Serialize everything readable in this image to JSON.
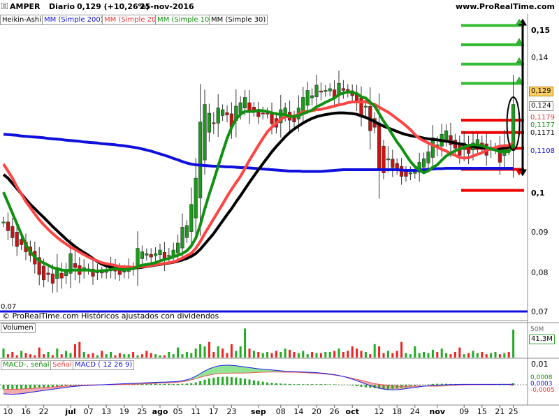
{
  "header": {
    "ticker": "AMPER",
    "period": "Diario",
    "last": "0,129 (+10,26%)",
    "date": "25-nov-2016",
    "site": "www.ProRealTime.com"
  },
  "legend": {
    "chart_style": "Heikin-Ashi",
    "ma200": "MM (Simple 200)",
    "ma20": "MM (Simple 20)",
    "ma10": "MM (Simple 10)",
    "ma30": "MM (Simple 30)"
  },
  "colors": {
    "up": "#1a9a1a",
    "down": "#cc1111",
    "ma200": "#1010dd",
    "ma20": "#ff4444",
    "ma10": "#109010",
    "ma30": "#000000",
    "level_green": "#33bb33",
    "level_red": "#ee0000",
    "macd_line": "#1a1aee",
    "signal_line": "#ee5555"
  },
  "source_text": "© ProRealTime.com Históricos ajustados con dividendos",
  "low_label": "0,07",
  "price_labels": {
    "last": "0,129",
    "mid": "0,124",
    "ma20": "0,1179",
    "ma10": "0,1177",
    "ma30": "0,1171",
    "ma200": "0,1108"
  },
  "volume_panel": {
    "title": "Volumen",
    "value": "41,3M",
    "scale": "50M"
  },
  "macd_panel": {
    "title_hist": "MACD-, señal",
    "title_signal": "Señal",
    "title_macd": "MACD ( 12 26 9)",
    "top_tick": "0,01",
    "hist_value": "0,0008",
    "macd_value": "0,0003",
    "signal_value": "-0,0005"
  },
  "chart_data": {
    "type": "candlestick",
    "ylim": [
      0.07,
      0.156
    ],
    "yticks": [
      "0,15",
      "0,14",
      "0,129",
      "0,124",
      "0,1",
      "0,09",
      "0,08",
      "0,07"
    ],
    "xticks": [
      {
        "label": "10",
        "i": 1
      },
      {
        "label": "16",
        "i": 5
      },
      {
        "label": "22",
        "i": 9
      },
      {
        "label": "jul",
        "i": 15,
        "month": true
      },
      {
        "label": "07",
        "i": 19
      },
      {
        "label": "13",
        "i": 23
      },
      {
        "label": "19",
        "i": 27
      },
      {
        "label": "25",
        "i": 31
      },
      {
        "label": "ago",
        "i": 35,
        "month": true
      },
      {
        "label": "05",
        "i": 39
      },
      {
        "label": "11",
        "i": 43
      },
      {
        "label": "17",
        "i": 47
      },
      {
        "label": "23",
        "i": 51
      },
      {
        "label": "sep",
        "i": 57,
        "month": true
      },
      {
        "label": "08",
        "i": 62
      },
      {
        "label": "14",
        "i": 66
      },
      {
        "label": "20",
        "i": 70
      },
      {
        "label": "26",
        "i": 74
      },
      {
        "label": "oct",
        "i": 78,
        "month": true
      },
      {
        "label": "12",
        "i": 84
      },
      {
        "label": "18",
        "i": 88
      },
      {
        "label": "24",
        "i": 92
      },
      {
        "label": "nov",
        "i": 97,
        "month": true
      },
      {
        "label": "09",
        "i": 103
      },
      {
        "label": "15",
        "i": 107
      },
      {
        "label": "21",
        "i": 111
      },
      {
        "label": "25",
        "i": 114
      }
    ],
    "close": [
      0.0955,
      0.093,
      0.091,
      0.0885,
      0.089,
      0.087,
      0.086,
      0.0835,
      0.0805,
      0.079,
      0.0805,
      0.078,
      0.0825,
      0.0795,
      0.0815,
      0.0865,
      0.0825,
      0.0805,
      0.0825,
      0.082,
      0.08,
      0.0815,
      0.081,
      0.082,
      0.0835,
      0.0815,
      0.0805,
      0.0815,
      0.083,
      0.082,
      0.088,
      0.087,
      0.0865,
      0.0855,
      0.0865,
      0.0875,
      0.0845,
      0.086,
      0.0875,
      0.0895,
      0.094,
      0.0945,
      0.1005,
      0.108,
      0.124,
      0.129,
      0.1265,
      0.1235,
      0.128,
      0.1275,
      0.126,
      0.1225,
      0.1285,
      0.1295,
      0.131,
      0.127,
      0.127,
      0.1255,
      0.1265,
      0.1265,
      0.1235,
      0.1225,
      0.1275,
      0.128,
      0.1245,
      0.124,
      0.128,
      0.131,
      0.133,
      0.1315,
      0.1345,
      0.1325,
      0.133,
      0.1335,
      0.131,
      0.135,
      0.133,
      0.1325,
      0.1315,
      0.1295,
      0.126,
      0.1285,
      0.1215,
      0.1225,
      0.1105,
      0.1095,
      0.1135,
      0.111,
      0.1105,
      0.1085,
      0.1085,
      0.1095,
      0.11,
      0.1125,
      0.1135,
      0.1155,
      0.1195,
      0.1175,
      0.1205,
      0.1215,
      0.1175,
      0.1165,
      0.1145,
      0.118,
      0.115,
      0.118,
      0.119,
      0.1175,
      0.1145,
      0.1165,
      0.1165,
      0.1125,
      0.1175,
      0.117,
      0.129
    ],
    "ma10": [
      0.104,
      0.101,
      0.098,
      0.095,
      0.092,
      0.089,
      0.087,
      0.0855,
      0.0845,
      0.0838,
      0.0832,
      0.0825,
      0.0822,
      0.0818,
      0.0817,
      0.0818,
      0.0818,
      0.0818,
      0.0818,
      0.0818,
      0.0815,
      0.0815,
      0.0816,
      0.0817,
      0.082,
      0.0822,
      0.082,
      0.0819,
      0.0821,
      0.0822,
      0.0828,
      0.0832,
      0.0834,
      0.0836,
      0.0839,
      0.0844,
      0.0848,
      0.0851,
      0.0856,
      0.086,
      0.0865,
      0.0873,
      0.0887,
      0.0909,
      0.0946,
      0.0992,
      0.1034,
      0.1073,
      0.1114,
      0.1154,
      0.1193,
      0.1224,
      0.1248,
      0.1262,
      0.127,
      0.127,
      0.127,
      0.1273,
      0.1272,
      0.127,
      0.1266,
      0.1263,
      0.1262,
      0.1261,
      0.1256,
      0.1256,
      0.1258,
      0.1264,
      0.1269,
      0.1274,
      0.1283,
      0.1289,
      0.1296,
      0.1302,
      0.1308,
      0.1318,
      0.1322,
      0.1326,
      0.1324,
      0.1321,
      0.1312,
      0.1308,
      0.1296,
      0.1285,
      0.1264,
      0.1242,
      0.1224,
      0.1203,
      0.1183,
      0.1166,
      0.1146,
      0.1127,
      0.1113,
      0.1103,
      0.1095,
      0.1101,
      0.1111,
      0.1118,
      0.1131,
      0.1143,
      0.1151,
      0.1158,
      0.1163,
      0.1169,
      0.1173,
      0.1175,
      0.1174,
      0.1172,
      0.1168,
      0.1163,
      0.116,
      0.1155,
      0.1157,
      0.1155,
      0.1177
    ],
    "ma20": [
      0.112,
      0.11,
      0.108,
      0.1055,
      0.1035,
      0.1013,
      0.0996,
      0.0978,
      0.0961,
      0.0947,
      0.0934,
      0.0922,
      0.0911,
      0.0901,
      0.0892,
      0.0883,
      0.0877,
      0.0869,
      0.0862,
      0.0855,
      0.0849,
      0.0844,
      0.0839,
      0.0836,
      0.0834,
      0.0831,
      0.0828,
      0.0827,
      0.0827,
      0.0826,
      0.0826,
      0.0828,
      0.0829,
      0.0831,
      0.0833,
      0.0835,
      0.0837,
      0.0839,
      0.0841,
      0.0846,
      0.0852,
      0.0859,
      0.0866,
      0.088,
      0.0899,
      0.0922,
      0.0943,
      0.0964,
      0.0985,
      0.1006,
      0.1028,
      0.1048,
      0.1067,
      0.1085,
      0.1108,
      0.1131,
      0.1152,
      0.1173,
      0.1193,
      0.1212,
      0.1225,
      0.1236,
      0.1248,
      0.1255,
      0.1255,
      0.1256,
      0.1262,
      0.1269,
      0.127,
      0.1272,
      0.1275,
      0.1276,
      0.1279,
      0.1282,
      0.1285,
      0.1289,
      0.1291,
      0.1295,
      0.1297,
      0.1297,
      0.1297,
      0.1298,
      0.1293,
      0.129,
      0.1282,
      0.1275,
      0.1268,
      0.1259,
      0.1249,
      0.124,
      0.1229,
      0.1218,
      0.1204,
      0.1193,
      0.1186,
      0.118,
      0.1174,
      0.1168,
      0.1162,
      0.1157,
      0.115,
      0.1145,
      0.1139,
      0.1137,
      0.1138,
      0.1143,
      0.1148,
      0.1152,
      0.116,
      0.1163,
      0.1167,
      0.1171,
      0.1172,
      0.1173,
      0.1179
    ],
    "ma30": [
      0.109,
      0.108,
      0.1065,
      0.105,
      0.1035,
      0.102,
      0.1005,
      0.0993,
      0.098,
      0.0968,
      0.0955,
      0.0942,
      0.093,
      0.0918,
      0.0906,
      0.0895,
      0.0885,
      0.0876,
      0.0868,
      0.086,
      0.0851,
      0.0842,
      0.0835,
      0.083,
      0.0826,
      0.0824,
      0.0822,
      0.0822,
      0.0822,
      0.0823,
      0.0825,
      0.0826,
      0.0828,
      0.083,
      0.0832,
      0.0834,
      0.0836,
      0.0838,
      0.084,
      0.0843,
      0.0847,
      0.0851,
      0.0857,
      0.0865,
      0.0877,
      0.0892,
      0.0907,
      0.0922,
      0.094,
      0.0958,
      0.0976,
      0.0993,
      0.1012,
      0.103,
      0.1049,
      0.1068,
      0.1086,
      0.1104,
      0.1121,
      0.1138,
      0.1155,
      0.117,
      0.1184,
      0.1198,
      0.121,
      0.122,
      0.1229,
      0.1237,
      0.1244,
      0.125,
      0.1255,
      0.1258,
      0.1261,
      0.1263,
      0.1265,
      0.1266,
      0.1266,
      0.1265,
      0.1264,
      0.1262,
      0.1257,
      0.1253,
      0.1247,
      0.1241,
      0.1234,
      0.1228,
      0.1223,
      0.1218,
      0.1213,
      0.1208,
      0.1204,
      0.1201,
      0.1199,
      0.1197,
      0.1194,
      0.1192,
      0.119,
      0.1189,
      0.1187,
      0.1185,
      0.1183,
      0.118,
      0.1178,
      0.1175,
      0.1172,
      0.117,
      0.1168,
      0.1166,
      0.1165,
      0.1164,
      0.1164,
      0.1164,
      0.1166,
      0.1168,
      0.1171
    ],
    "ma200": [
      0.1205,
      0.1204,
      0.1203,
      0.1202,
      0.12,
      0.1199,
      0.1198,
      0.1197,
      0.1196,
      0.1195,
      0.1193,
      0.1192,
      0.1191,
      0.119,
      0.1188,
      0.1187,
      0.1186,
      0.1185,
      0.1183,
      0.1182,
      0.1181,
      0.118,
      0.1178,
      0.1177,
      0.1176,
      0.1175,
      0.1173,
      0.1172,
      0.117,
      0.1168,
      0.1166,
      0.1163,
      0.116,
      0.1157,
      0.1153,
      0.1149,
      0.1145,
      0.1141,
      0.1136,
      0.1132,
      0.1127,
      0.1123,
      0.112,
      0.1118,
      0.1117,
      0.1116,
      0.1115,
      0.1114,
      0.1114,
      0.1113,
      0.1112,
      0.1112,
      0.1111,
      0.111,
      0.111,
      0.1109,
      0.1108,
      0.1107,
      0.1106,
      0.1105,
      0.1104,
      0.1103,
      0.1102,
      0.1101,
      0.11,
      0.11,
      0.11,
      0.1099,
      0.1099,
      0.1099,
      0.1099,
      0.1099,
      0.11,
      0.1101,
      0.1102,
      0.1103,
      0.1104,
      0.1104,
      0.1104,
      0.1104,
      0.1104,
      0.1104,
      0.1104,
      0.1104,
      0.1104,
      0.1104,
      0.1104,
      0.1104,
      0.1104,
      0.1103,
      0.1102,
      0.1102,
      0.1102,
      0.1103,
      0.1104,
      0.1105,
      0.1106,
      0.1107,
      0.1107,
      0.1108,
      0.1108,
      0.1108,
      0.1108,
      0.1108,
      0.1108,
      0.1108,
      0.1108,
      0.1108,
      0.1108,
      0.1108,
      0.1108,
      0.1108,
      0.1108,
      0.1108,
      0.1108
    ],
    "levels_green": [
      0.1515,
      0.146,
      0.1405,
      0.135
    ],
    "levels_red": [
      0.1245,
      0.121,
      0.1165,
      0.1105,
      0.1045
    ],
    "volume": [
      8,
      3,
      5,
      2,
      6,
      4,
      3,
      2,
      9,
      3,
      5,
      2,
      8,
      3,
      6,
      4,
      12,
      14,
      5,
      3,
      4,
      2,
      6,
      3,
      5,
      2,
      4,
      3,
      3,
      5,
      2,
      3,
      6,
      4,
      3,
      2,
      2,
      5,
      3,
      9,
      3,
      5,
      4,
      8,
      12,
      10,
      14,
      5,
      10,
      8,
      4,
      12,
      6,
      10,
      26,
      8,
      6,
      5,
      4,
      5,
      4,
      6,
      5,
      8,
      7,
      5,
      4,
      6,
      3,
      5,
      4,
      4,
      5,
      5,
      6,
      8,
      5,
      6,
      10,
      8,
      6,
      5,
      3,
      12,
      10,
      4,
      6,
      4,
      6,
      14,
      4,
      3,
      10,
      4,
      5,
      4,
      7,
      5,
      8,
      4,
      3,
      5,
      9,
      3,
      4,
      6,
      4,
      5,
      3,
      4,
      5,
      3,
      4,
      5,
      25
    ],
    "macd_hist": [
      -0.0022,
      -0.0024,
      -0.0025,
      -0.0024,
      -0.0023,
      -0.0021,
      -0.0019,
      -0.0017,
      -0.0016,
      -0.0014,
      -0.0012,
      -0.0011,
      -0.001,
      -0.0009,
      -0.0007,
      -0.0005,
      -0.0004,
      -0.0003,
      -0.0002,
      -0.0002,
      -0.0001,
      -0.0001,
      0.0,
      0.0001,
      0.0002,
      0.0002,
      0.0003,
      0.0003,
      0.0004,
      0.0004,
      0.0005,
      0.0005,
      0.0005,
      0.0005,
      0.0005,
      0.0004,
      0.0004,
      0.0004,
      0.0004,
      0.0004,
      0.0005,
      0.0006,
      0.0008,
      0.0012,
      0.0018,
      0.0025,
      0.0031,
      0.0035,
      0.0038,
      0.0039,
      0.004,
      0.0038,
      0.0036,
      0.0033,
      0.003,
      0.0026,
      0.0022,
      0.0018,
      0.0015,
      0.0012,
      0.001,
      0.0008,
      0.0006,
      0.0005,
      0.0004,
      0.0003,
      0.0003,
      0.0003,
      0.0003,
      0.0003,
      0.0003,
      0.0003,
      0.0003,
      0.0002,
      0.0002,
      0.0001,
      0.0,
      -0.0002,
      -0.0004,
      -0.0007,
      -0.001,
      -0.0013,
      -0.0015,
      -0.0017,
      -0.0019,
      -0.0021,
      -0.0022,
      -0.002,
      -0.0018,
      -0.0015,
      -0.0012,
      -0.0009,
      -0.0006,
      -0.0003,
      0.0,
      0.0002,
      0.0004,
      0.0005,
      0.0005,
      0.0005,
      0.0004,
      0.0004,
      0.0003,
      0.0003,
      0.0002,
      0.0002,
      0.0002,
      0.0001,
      0.0001,
      0.0001,
      0.0001,
      0.0,
      0.0,
      0.0001,
      0.0008
    ],
    "macd_line": [
      -0.0045,
      -0.0046,
      -0.0047,
      -0.0046,
      -0.0044,
      -0.0041,
      -0.0038,
      -0.0034,
      -0.0031,
      -0.0028,
      -0.0025,
      -0.0022,
      -0.0019,
      -0.0016,
      -0.0013,
      -0.001,
      -0.0008,
      -0.0006,
      -0.0004,
      -0.0003,
      -0.0002,
      -0.0001,
      0.0,
      0.0001,
      0.0002,
      0.0003,
      0.0004,
      0.0005,
      0.0006,
      0.0007,
      0.0008,
      0.0009,
      0.001,
      0.0011,
      0.0012,
      0.0013,
      0.0013,
      0.0014,
      0.0015,
      0.0017,
      0.002,
      0.0025,
      0.0032,
      0.0042,
      0.0055,
      0.0068,
      0.0079,
      0.0087,
      0.0093,
      0.0096,
      0.0097,
      0.0096,
      0.0094,
      0.0091,
      0.0088,
      0.0085,
      0.0082,
      0.0079,
      0.0077,
      0.0075,
      0.0073,
      0.0071,
      0.0069,
      0.0067,
      0.0066,
      0.0065,
      0.0064,
      0.0063,
      0.0062,
      0.0061,
      0.006,
      0.0058,
      0.0056,
      0.0053,
      0.005,
      0.0046,
      0.0041,
      0.0035,
      0.0028,
      0.002,
      0.0012,
      0.0004,
      -0.0004,
      -0.0011,
      -0.0017,
      -0.0021,
      -0.0024,
      -0.0025,
      -0.0024,
      -0.0022,
      -0.0019,
      -0.0016,
      -0.0013,
      -0.001,
      -0.0007,
      -0.0005,
      -0.0003,
      -0.0002,
      -0.0001,
      0.0,
      0.0001,
      0.0001,
      0.0002,
      0.0002,
      0.0002,
      0.0002,
      0.0002,
      0.0002,
      0.0002,
      0.0002,
      0.0002,
      0.0002,
      0.0002,
      0.0002,
      0.0003
    ],
    "macd_signal": [
      -0.0023,
      -0.0022,
      -0.0022,
      -0.0022,
      -0.0021,
      -0.002,
      -0.0019,
      -0.0017,
      -0.0015,
      -0.0014,
      -0.0013,
      -0.0011,
      -0.0009,
      -0.0007,
      -0.0006,
      -0.0005,
      -0.0004,
      -0.0003,
      -0.0002,
      -0.0001,
      -0.0001,
      0.0,
      0.0,
      0.0,
      0.0,
      0.0001,
      0.0001,
      0.0002,
      0.0002,
      0.0003,
      0.0003,
      0.0004,
      0.0005,
      0.0006,
      0.0007,
      0.0009,
      0.0009,
      0.001,
      0.0011,
      0.0013,
      0.0015,
      0.0019,
      0.0024,
      0.003,
      0.0037,
      0.0043,
      0.0048,
      0.0052,
      0.0055,
      0.0057,
      0.0057,
      0.0058,
      0.0058,
      0.0058,
      0.0058,
      0.0059,
      0.006,
      0.0061,
      0.0062,
      0.0063,
      0.0063,
      0.0063,
      0.0063,
      0.0062,
      0.0062,
      0.0062,
      0.0061,
      0.006,
      0.0059,
      0.0058,
      0.0057,
      0.0055,
      0.0053,
      0.0051,
      0.0048,
      0.0045,
      0.0041,
      0.0037,
      0.0032,
      0.0027,
      0.0022,
      0.0017,
      0.0011,
      0.0006,
      0.0002,
      0.0,
      -0.0002,
      -0.0005,
      -0.0006,
      -0.0007,
      -0.0007,
      -0.0007,
      -0.0007,
      -0.0007,
      -0.0007,
      -0.0007,
      -0.0007,
      -0.0007,
      -0.0006,
      -0.0005,
      -0.0003,
      -0.0003,
      -0.0001,
      -0.0001,
      0.0,
      0.0,
      0.0,
      0.0001,
      0.0001,
      0.0001,
      0.0001,
      0.0002,
      0.0002,
      0.0001,
      -0.0005
    ]
  }
}
